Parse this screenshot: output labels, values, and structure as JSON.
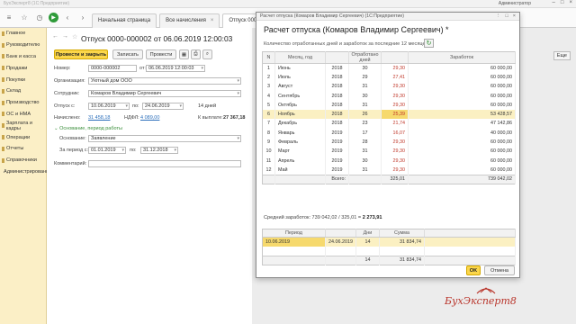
{
  "titlebar": {
    "app": "БухЭксперт8 (1С:Предприятие)",
    "user": "Администратор"
  },
  "tabs": [
    {
      "label": "Начальная страница"
    },
    {
      "label": "Все начисления"
    },
    {
      "label": "Отпуск 0000-000002 от 06.06.2019..."
    }
  ],
  "sidebar": {
    "items": [
      "Главное",
      "Руководителю",
      "Банк и касса",
      "Продажи",
      "Покупки",
      "Склад",
      "Производство",
      "ОС и НМА",
      "Зарплата и кадры",
      "Операции",
      "Отчеты",
      "Справочники",
      "Администрирование"
    ]
  },
  "form": {
    "title": "Отпуск 0000-000002 от 06.06.2019 12:00:03",
    "buttons": {
      "post_close": "Провести и закрыть",
      "save": "Записать",
      "post": "Провести"
    },
    "number_label": "Номер:",
    "number_value": "0000-000002",
    "date_label": "от:",
    "date_value": "06.06.2019 12:00:03",
    "org_label": "Организация:",
    "org_value": "Уютный дом ООО",
    "emp_label": "Сотрудник:",
    "emp_value": "Комаров Владимир Сергеевич",
    "vac_label": "Отпуск с:",
    "vac_from": "10.06.2019",
    "vac_to_label": "по:",
    "vac_to": "24.06.2019",
    "vac_days": "14 дней",
    "accrued_label": "Начислено:",
    "accrued_value": "31 458,18",
    "ndfl_label": "НДФЛ:",
    "ndfl_value": "4 089,00",
    "payout_label": "К выплате:",
    "payout_value": "27 367,18",
    "basis_link": "Основание, период работы",
    "basis_label": "Основание:",
    "basis_value": "Заявление",
    "period_label": "За период с:",
    "period_from": "01.01.2019",
    "period_to_label": "по:",
    "period_to": "31.12.2018",
    "comment_label": "Комментарий:",
    "esc_label": "Еще"
  },
  "dialog": {
    "header": "Расчет отпуска (Комаров Владимир Сергеевич) (1С:Предприятие)",
    "title": "Расчет отпуска (Комаров Владимир Сергеевич) *",
    "subtitle": "Количество отработанных дней и заработок за последние 12 месяцев",
    "columns": [
      "N",
      "Месяц, год",
      "",
      "Отработано дней",
      "",
      "Заработок"
    ],
    "rows": [
      {
        "n": "1",
        "month": "Июнь",
        "year": "2018",
        "days": "30",
        "coef": "29,30",
        "earn": "60 000,00"
      },
      {
        "n": "2",
        "month": "Июль",
        "year": "2018",
        "days": "29",
        "coef": "27,41",
        "earn": "60 000,00"
      },
      {
        "n": "3",
        "month": "Август",
        "year": "2018",
        "days": "31",
        "coef": "29,30",
        "earn": "60 000,00"
      },
      {
        "n": "4",
        "month": "Сентябрь",
        "year": "2018",
        "days": "30",
        "coef": "29,30",
        "earn": "60 000,00"
      },
      {
        "n": "5",
        "month": "Октябрь",
        "year": "2018",
        "days": "31",
        "coef": "29,30",
        "earn": "60 000,00"
      },
      {
        "n": "6",
        "month": "Ноябрь",
        "year": "2018",
        "days": "26",
        "coef": "25,39",
        "earn": "53 428,57"
      },
      {
        "n": "7",
        "month": "Декабрь",
        "year": "2018",
        "days": "23",
        "coef": "21,74",
        "earn": "47 142,86"
      },
      {
        "n": "8",
        "month": "Январь",
        "year": "2019",
        "days": "17",
        "coef": "16,07",
        "earn": "40 000,00"
      },
      {
        "n": "9",
        "month": "Февраль",
        "year": "2019",
        "days": "28",
        "coef": "29,30",
        "earn": "60 000,00"
      },
      {
        "n": "10",
        "month": "Март",
        "year": "2019",
        "days": "31",
        "coef": "29,30",
        "earn": "60 000,00"
      },
      {
        "n": "11",
        "month": "Апрель",
        "year": "2019",
        "days": "30",
        "coef": "29,30",
        "earn": "60 000,00"
      },
      {
        "n": "12",
        "month": "Май",
        "year": "2019",
        "days": "31",
        "coef": "29,30",
        "earn": "60 000,00"
      }
    ],
    "total_label": "Всего:",
    "total_coef": "325,01",
    "total_earn": "739 042,02",
    "avg_text": "Средний заработок: 739 042,02 / 325,01 =",
    "avg_value": "2 273,91",
    "period_table": {
      "columns": [
        "Период",
        "",
        "Дни",
        "Сумма"
      ],
      "row": {
        "from": "10.06.2019",
        "to": "24.06.2019",
        "days": "14",
        "sum": "31 834,74"
      },
      "total_days": "14",
      "total_sum": "31 834,74"
    },
    "ok_label": "OK",
    "cancel_label": "Отмена"
  },
  "logo": "БухЭксперт8"
}
